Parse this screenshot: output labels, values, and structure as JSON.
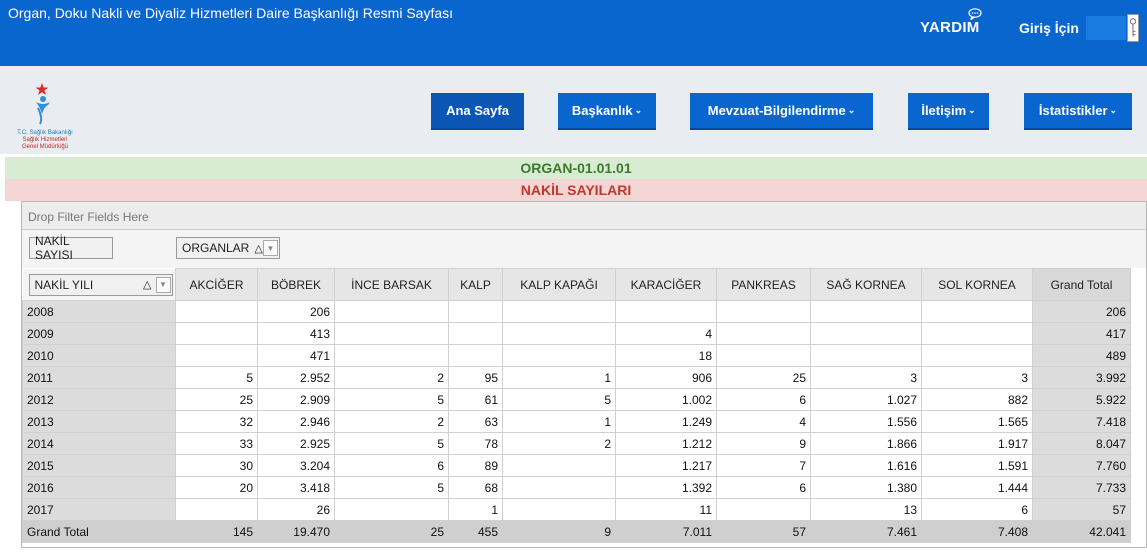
{
  "header": {
    "site_title": "Organ, Doku Nakli ve Diyaliz Hizmetleri Daire Başkanlığı Resmi Sayfası",
    "help_label": "YARDIM",
    "login_label": "Giriş İçin"
  },
  "logo": {
    "line1": "T.C. Sağlık Bakanlığı",
    "line2": "Sağlık Hizmetleri",
    "line3": "Genel Müdürlüğü"
  },
  "nav": [
    {
      "label": "Ana Sayfa"
    },
    {
      "label": "Başkanlık"
    },
    {
      "label": "Mevzuat-Bilgilendirme"
    },
    {
      "label": "İletişim"
    },
    {
      "label": "İstatistikler"
    }
  ],
  "bands": {
    "code": "ORGAN-01.01.01",
    "title": "NAKİL SAYILARI"
  },
  "pivot": {
    "drop_filter": "Drop Filter Fields Here",
    "data_field": "NAKİL SAYISI",
    "column_field": "ORGANLAR",
    "row_field": "NAKİL YILI",
    "sort_glyph": "△",
    "columns": [
      "AKCİĞER",
      "BÖBREK",
      "İNCE BARSAK",
      "KALP",
      "KALP KAPAĞI",
      "KARACİĞER",
      "PANKREAS",
      "SAĞ KORNEA",
      "SOL KORNEA",
      "Grand Total"
    ],
    "rows": [
      {
        "label": "2008",
        "cells": [
          "",
          "206",
          "",
          "",
          "",
          "",
          "",
          "",
          "",
          "206"
        ]
      },
      {
        "label": "2009",
        "cells": [
          "",
          "413",
          "",
          "",
          "",
          "4",
          "",
          "",
          "",
          "417"
        ]
      },
      {
        "label": "2010",
        "cells": [
          "",
          "471",
          "",
          "",
          "",
          "18",
          "",
          "",
          "",
          "489"
        ]
      },
      {
        "label": "2011",
        "cells": [
          "5",
          "2.952",
          "2",
          "95",
          "1",
          "906",
          "25",
          "3",
          "3",
          "3.992"
        ]
      },
      {
        "label": "2012",
        "cells": [
          "25",
          "2.909",
          "5",
          "61",
          "5",
          "1.002",
          "6",
          "1.027",
          "882",
          "5.922"
        ]
      },
      {
        "label": "2013",
        "cells": [
          "32",
          "2.946",
          "2",
          "63",
          "1",
          "1.249",
          "4",
          "1.556",
          "1.565",
          "7.418"
        ]
      },
      {
        "label": "2014",
        "cells": [
          "33",
          "2.925",
          "5",
          "78",
          "2",
          "1.212",
          "9",
          "1.866",
          "1.917",
          "8.047"
        ]
      },
      {
        "label": "2015",
        "cells": [
          "30",
          "3.204",
          "6",
          "89",
          "",
          "1.217",
          "7",
          "1.616",
          "1.591",
          "7.760"
        ]
      },
      {
        "label": "2016",
        "cells": [
          "20",
          "3.418",
          "5",
          "68",
          "",
          "1.392",
          "6",
          "1.380",
          "1.444",
          "7.733"
        ]
      },
      {
        "label": "2017",
        "cells": [
          "",
          "26",
          "",
          "1",
          "",
          "11",
          "",
          "13",
          "6",
          "57"
        ]
      }
    ],
    "grand_total": {
      "label": "Grand Total",
      "cells": [
        "145",
        "19.470",
        "25",
        "455",
        "9",
        "7.011",
        "57",
        "7.461",
        "7.408",
        "42.041"
      ]
    }
  }
}
